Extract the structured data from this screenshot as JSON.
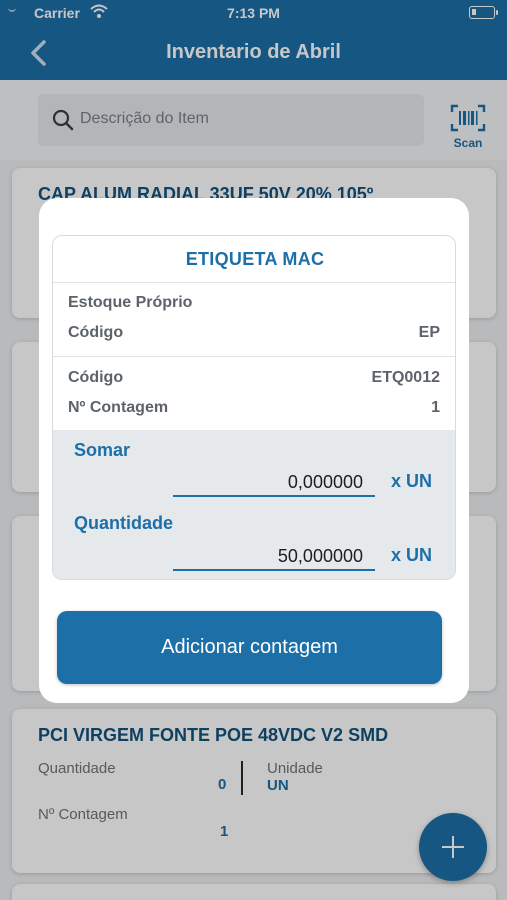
{
  "status_bar": {
    "carrier": "Carrier",
    "time": "7:13 PM"
  },
  "nav": {
    "title": "Inventario de Abril",
    "back_icon": "chevron-left-icon"
  },
  "search": {
    "placeholder": "Descrição do Item",
    "scan_label": "Scan"
  },
  "list": {
    "card1": {
      "title": "CAP ALUM RADIAL 33UF 50V 20% 105º"
    },
    "card4": {
      "title": "PCI VIRGEM FONTE POE 48VDC V2 SMD",
      "quantidade_label": "Quantidade",
      "quantidade_value": "0",
      "unidade_label": "Unidade",
      "unidade_value": "UN",
      "contagem_label": "Nº Contagem",
      "contagem_value": "1"
    }
  },
  "modal": {
    "title": "ETIQUETA MAC",
    "estoque_label": "Estoque Próprio",
    "codigo1_label": "Código",
    "codigo1_value": "EP",
    "codigo2_label": "Código",
    "codigo2_value": "ETQ0012",
    "contagem_label": "Nº Contagem",
    "contagem_value": "1",
    "somar_label": "Somar",
    "somar_value": "0,000000",
    "somar_unit": "x UN",
    "quantidade_label": "Quantidade",
    "quantidade_value": "50,000000",
    "quantidade_unit": "x UN",
    "button_label": "Adicionar contagem"
  },
  "colors": {
    "primary": "#1d6fa8",
    "title_text": "#12527e",
    "input_bg": "#e5e9ec"
  }
}
